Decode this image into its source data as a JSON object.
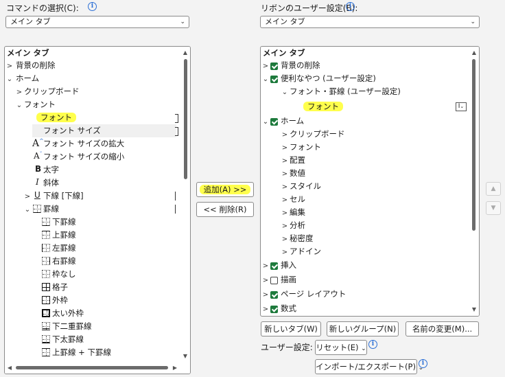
{
  "left": {
    "label": "コマンドの選択(C):",
    "dropdown_value": "メイン タブ",
    "tree": {
      "header": "メイン タブ",
      "items": [
        {
          "text": "背景の削除"
        },
        {
          "text": "ホーム"
        },
        {
          "text": "クリップボード"
        },
        {
          "text": "フォント"
        },
        {
          "text": "フォント"
        },
        {
          "text": "フォント サイズ"
        },
        {
          "text": "フォント サイズの拡大"
        },
        {
          "text": "フォント サイズの縮小"
        },
        {
          "text": "太字"
        },
        {
          "text": "斜体"
        },
        {
          "text": "下線 [下線]"
        },
        {
          "text": "罫線"
        },
        {
          "text": "下罫線"
        },
        {
          "text": "上罫線"
        },
        {
          "text": "左罫線"
        },
        {
          "text": "右罫線"
        },
        {
          "text": "枠なし"
        },
        {
          "text": "格子"
        },
        {
          "text": "外枠"
        },
        {
          "text": "太い外枠"
        },
        {
          "text": "下二重罫線"
        },
        {
          "text": "下太罫線"
        },
        {
          "text": "上罫線 + 下罫線"
        }
      ],
      "icon_font_size_up": "A",
      "icon_font_size_down": "A",
      "icon_bold": "B",
      "icon_italic": "I",
      "icon_underline": "U"
    }
  },
  "middle": {
    "add_label": "追加(A) >>",
    "remove_label": "<< 削除(R)"
  },
  "right": {
    "label": "リボンのユーザー設定(B):",
    "dropdown_value": "メイン タブ",
    "tree": {
      "header": "メイン タブ",
      "items": [
        {
          "text": "背景の削除"
        },
        {
          "text": "便利なやつ (ユーザー設定)"
        },
        {
          "text": "フォント・罫線 (ユーザー設定)"
        },
        {
          "text": "フォント"
        },
        {
          "text": "ホーム"
        },
        {
          "text": "クリップボード"
        },
        {
          "text": "フォント"
        },
        {
          "text": "配置"
        },
        {
          "text": "数値"
        },
        {
          "text": "スタイル"
        },
        {
          "text": "セル"
        },
        {
          "text": "編集"
        },
        {
          "text": "分析"
        },
        {
          "text": "秘密度"
        },
        {
          "text": "アドイン"
        },
        {
          "text": "挿入"
        },
        {
          "text": "描画"
        },
        {
          "text": "ページ レイアウト"
        },
        {
          "text": "数式"
        }
      ],
      "combo_icon": "I"
    },
    "new_tab_label": "新しいタブ(W)",
    "new_group_label": "新しいグループ(N)",
    "rename_label": "名前の変更(M)...",
    "user_settings_label": "ユーザー設定:",
    "reset_label": "リセット(E)",
    "import_export_label": "インポート/エクスポート(P)"
  },
  "colors": {
    "check_green": "#1d7a3c",
    "highlight_yellow": "#ffff4d",
    "info_blue": "#2b6fd6"
  }
}
